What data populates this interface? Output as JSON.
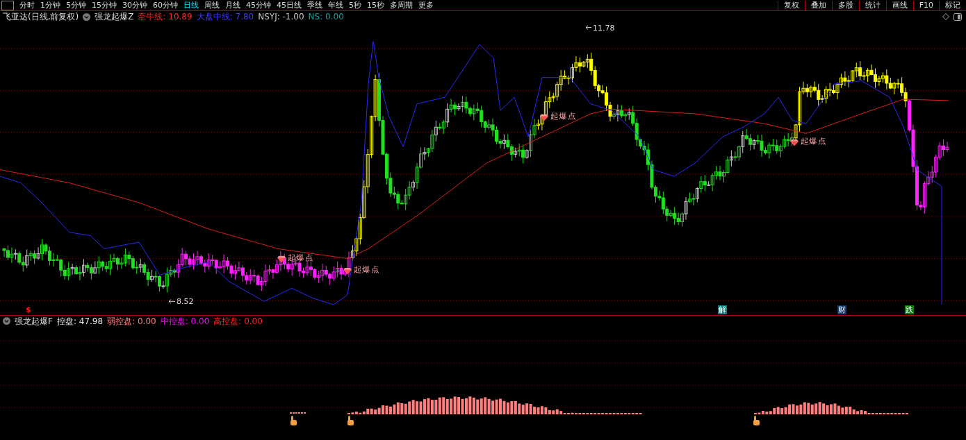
{
  "toolbar": {
    "periods": [
      {
        "label": "分时",
        "selected": false
      },
      {
        "label": "1分钟",
        "selected": false
      },
      {
        "label": "5分钟",
        "selected": false
      },
      {
        "label": "15分钟",
        "selected": false
      },
      {
        "label": "30分钟",
        "selected": false
      },
      {
        "label": "60分钟",
        "selected": false
      },
      {
        "label": "日线",
        "selected": true
      },
      {
        "label": "周线",
        "selected": false
      },
      {
        "label": "月线",
        "selected": false
      },
      {
        "label": "45分钟",
        "selected": false
      },
      {
        "label": "45日线",
        "selected": false
      },
      {
        "label": "季线",
        "selected": false
      },
      {
        "label": "年线",
        "selected": false
      },
      {
        "label": "5秒",
        "selected": false
      },
      {
        "label": "15秒",
        "selected": false
      },
      {
        "label": "多周期",
        "selected": false
      },
      {
        "label": "更多",
        "selected": false
      }
    ],
    "tools": [
      "复权",
      "叠加",
      "多股",
      "统计",
      "画线",
      "F10",
      "标记"
    ]
  },
  "main_panel": {
    "stock_title": "飞亚达(日线,前复权)",
    "indicator_name": "强龙起爆Z",
    "readouts": [
      {
        "text": "牵牛线: 10.89",
        "color": "#ff2a2a"
      },
      {
        "text": "大盘中线: 7.80",
        "color": "#3a3aff"
      },
      {
        "text": "NSYJ: -1.00",
        "color": "#c8c8c8"
      },
      {
        "text": "NS: 0.00",
        "color": "#1aa0a0"
      }
    ],
    "high_label": "11.78",
    "low_label": "8.52",
    "signals": [
      {
        "text": "起爆点"
      },
      {
        "text": "起爆点"
      },
      {
        "text": "起爆点"
      },
      {
        "text": "起爆点"
      }
    ],
    "event_markers": [
      {
        "text": "$",
        "color": "#ff1a1a"
      },
      {
        "text": "解",
        "color": "#0d8080"
      },
      {
        "text": "财",
        "color": "#0c3c6e"
      },
      {
        "text": "跌",
        "color": "#0b7a0b"
      }
    ]
  },
  "sub_panel": {
    "indicator_name": "强龙起爆F",
    "readouts": [
      {
        "text": "控盘: 47.98",
        "color": "#e6e6e6"
      },
      {
        "text": "弱控盘: 0.00",
        "color": "#ff8080"
      },
      {
        "text": "中控盘: 0.00",
        "color": "#ff00ff"
      },
      {
        "text": "高控盘: 0.00",
        "color": "#ff2020"
      }
    ]
  }
}
